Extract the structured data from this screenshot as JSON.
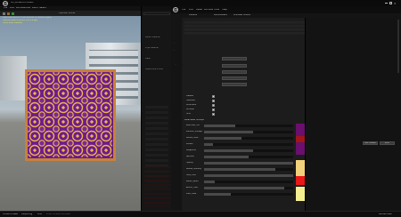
{
  "app": {
    "logo_text": "UE",
    "window_title": "SM_NoiseBoot.uasset"
  },
  "viewport": {
    "menu": [
      "File",
      "Edit",
      "Window",
      "Tools",
      "Build",
      "Select"
    ],
    "toolbar_button": "Update Scene",
    "overlay_lines": [
      "LIGHTING NEEDS TO BE REBUILT (1 unbuilt object)",
      "Texture streaming pool over budget",
      "Show Stats disabled"
    ]
  },
  "editor": {
    "menu": [
      "File",
      "Edit",
      "Asset",
      "Window",
      "Tools",
      "Help"
    ],
    "tabs": [
      "Details",
      "Parameters",
      "Preview Scene"
    ],
    "mid_sidebar_items": [
      "Material",
      "Parent",
      "Physical Material",
      "Lightmass",
      "Subsurface",
      "Usage",
      "Advanced"
    ],
    "left_details_labels": [
      "Parent Material",
      "Phys Material",
      "Mask",
      "Subsurface Profile"
    ],
    "params_header": "Parameter Groups",
    "params": [
      {
        "label": "BaseColor_Tint",
        "value": "0.35"
      },
      {
        "label": "Emissive_Strength",
        "value": "1.0"
      },
      {
        "label": "Pattern_Scale",
        "value": "4.2"
      },
      {
        "label": "Metallic",
        "value": "0.1"
      },
      {
        "label": "Roughness",
        "value": "0.55"
      },
      {
        "label": "Specular",
        "value": "0.5"
      },
      {
        "label": "Opacity",
        "value": "1.0"
      },
      {
        "label": "Normal_Intensity",
        "value": "0.8"
      },
      {
        "label": "Gold_Color",
        "value": "1.0"
      },
      {
        "label": "Border_Width",
        "value": "0.12"
      },
      {
        "label": "Accent_Color",
        "value": "0.9"
      },
      {
        "label": "Inner_Glow",
        "value": "0.3"
      }
    ],
    "right_buttons": [
      "Save Defaults",
      "Reset"
    ],
    "checkbox_labels": [
      "Masked",
      "Twosided",
      "Wireframe",
      "Dithered",
      "Unlit"
    ],
    "swatch_colors": [
      "#6a0f6e",
      "#a11616",
      "#6a0f6e",
      "#f2d27a",
      "#e81818",
      "#f4ef90"
    ]
  },
  "taskbar": {
    "items": [
      "Content Drawer",
      "Output Log",
      "Cmd",
      "Enter Console Command"
    ],
    "right_text": "Derived Data"
  }
}
